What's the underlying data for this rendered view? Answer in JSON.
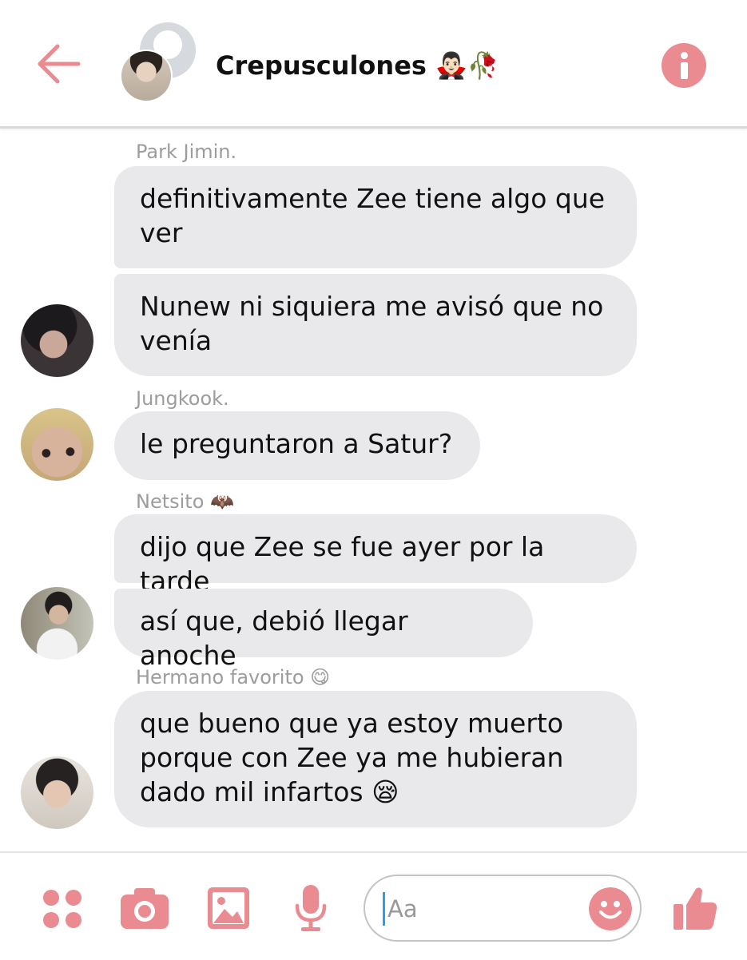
{
  "header": {
    "title": "Crepusculones",
    "title_emoji": "🧛🏻‍♂️🥀"
  },
  "messages": [
    {
      "sender": "Park Jimin.",
      "bubbles": [
        "definitivamente Zee tiene algo que ver",
        "Nunew ni siquiera me avisó que no venía"
      ]
    },
    {
      "sender": "Jungkook.",
      "bubbles": [
        "le preguntaron a Satur?"
      ]
    },
    {
      "sender": "Netsito 🦇",
      "bubbles": [
        "dijo que Zee se fue ayer por la tarde",
        "así que, debió llegar anoche"
      ]
    },
    {
      "sender": "Hermano favorito 😋",
      "bubbles": [
        "que bueno que ya estoy muerto porque con Zee ya me hubieran dado mil infartos 😪"
      ]
    }
  ],
  "composer": {
    "placeholder": "Aa"
  },
  "colors": {
    "accent": "#e98b90",
    "bubble": "#e9e9eb",
    "sender_name": "#9c9c9c"
  },
  "icons": [
    "back-arrow-icon",
    "info-icon",
    "apps-icon",
    "camera-icon",
    "gallery-icon",
    "microphone-icon",
    "emoji-icon",
    "thumbs-up-icon"
  ]
}
